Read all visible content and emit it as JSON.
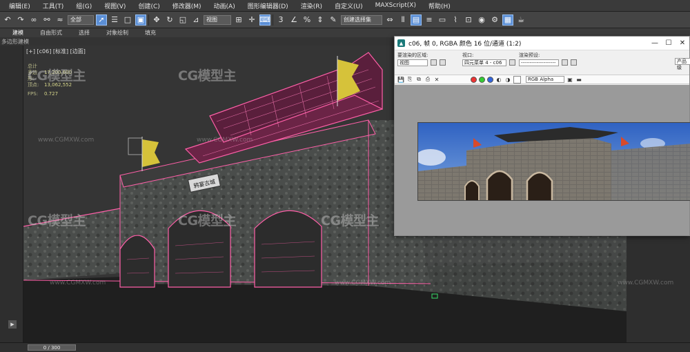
{
  "menubar": {
    "items": [
      "编辑(E)",
      "工具(T)",
      "组(G)",
      "视图(V)",
      "创建(C)",
      "修改器(M)",
      "动画(A)",
      "图形编辑器(D)",
      "渲染(R)",
      "自定义(U)",
      "MAXScript(X)",
      "帮助(H)"
    ]
  },
  "toolbar": {
    "selection_filter": "全部",
    "reference_coord": "视图",
    "named_selection": "创建选择集"
  },
  "ribbon": {
    "tabs": [
      "建模",
      "自由形式",
      "选择",
      "对象绘制",
      "填充"
    ],
    "active_tab": "建模",
    "sub_label": "多边形建模"
  },
  "viewport": {
    "label": "[+] [c06] [标准] [边面]",
    "stats": {
      "total_label": "总计",
      "poly_label": "多边形:",
      "poly_value": "17,200,600",
      "vert_label": "顶点:",
      "vert_value": "13,062,552",
      "fps_label": "FPS:",
      "fps_value": "0.727"
    },
    "plaque_text": "鸦宴古城"
  },
  "watermark": {
    "logo": "CG模型主",
    "url": "www.CGMXW.com"
  },
  "render_window": {
    "title": "c06, 帧 0, RGBA 颜色 16 位/通道 (1:2)",
    "area_label": "要渲染的区域:",
    "area_value": "视图",
    "viewport_label": "视口:",
    "viewport_value": "四元菜单 4 - c06",
    "preset_label": "渲染预设:",
    "preset_value": "--------------------",
    "product_label": "产品级",
    "channel_value": "RGB Alpha"
  },
  "bottombar": {
    "timeline": "0 / 300"
  },
  "colors": {
    "wireframe": "#ff5fa8",
    "viewport_bg": "#353535",
    "render_bg": "#9a9a9a",
    "accent_blue": "#5b8fd6"
  }
}
